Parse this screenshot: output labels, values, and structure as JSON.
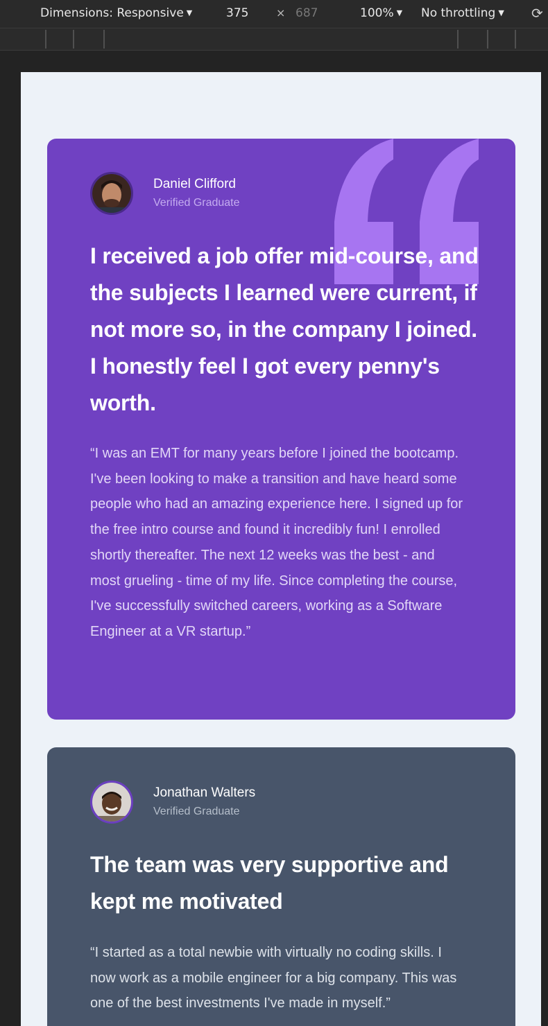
{
  "devtools": {
    "dimensions_label": "Dimensions: Responsive",
    "width": "375",
    "times": "×",
    "height": "687",
    "zoom": "100%",
    "throttling": "No throttling",
    "caret": "▼",
    "rotate_icon": "⟳"
  },
  "testimonials": [
    {
      "name": "Daniel Clifford",
      "role": "Verified Graduate",
      "headline": "I received a job offer mid-course, and the subjects I learned were current, if not more so, in the company I joined. I honestly feel I got every penny's worth.",
      "body": "“I was an EMT for many years before I joined the bootcamp. I've been looking to make a transition and have heard some people who had an amazing experience here. I signed up for the free intro course and found it incredibly fun! I enrolled shortly thereafter. The next 12 weeks was the best - and most grueling - time of my life. Since completing the course, I've successfully switched careers, working as a Software Engineer at a VR startup.”",
      "background": "#7041c2"
    },
    {
      "name": "Jonathan Walters",
      "role": "Verified Graduate",
      "headline": "The team was very supportive and kept me motivated",
      "body": "“I started as a total newbie with virtually no coding skills. I now work as a mobile engineer for a big company. This was one of the best investments I've made in myself.”",
      "background": "#48556a"
    }
  ],
  "colors": {
    "page_background": "#edf2f8",
    "quote_mark": "#a775f1"
  }
}
